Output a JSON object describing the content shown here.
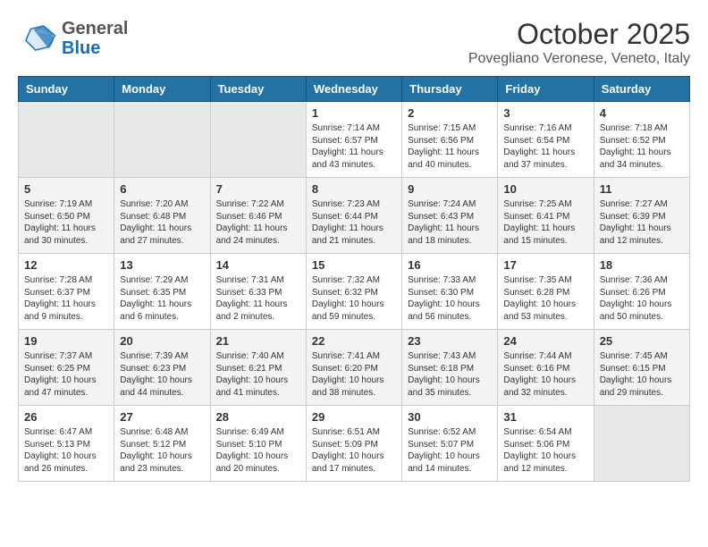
{
  "header": {
    "logo_general": "General",
    "logo_blue": "Blue",
    "month": "October 2025",
    "location": "Povegliano Veronese, Veneto, Italy"
  },
  "weekdays": [
    "Sunday",
    "Monday",
    "Tuesday",
    "Wednesday",
    "Thursday",
    "Friday",
    "Saturday"
  ],
  "weeks": [
    [
      {
        "day": "",
        "info": ""
      },
      {
        "day": "",
        "info": ""
      },
      {
        "day": "",
        "info": ""
      },
      {
        "day": "1",
        "info": "Sunrise: 7:14 AM\nSunset: 6:57 PM\nDaylight: 11 hours\nand 43 minutes."
      },
      {
        "day": "2",
        "info": "Sunrise: 7:15 AM\nSunset: 6:56 PM\nDaylight: 11 hours\nand 40 minutes."
      },
      {
        "day": "3",
        "info": "Sunrise: 7:16 AM\nSunset: 6:54 PM\nDaylight: 11 hours\nand 37 minutes."
      },
      {
        "day": "4",
        "info": "Sunrise: 7:18 AM\nSunset: 6:52 PM\nDaylight: 11 hours\nand 34 minutes."
      }
    ],
    [
      {
        "day": "5",
        "info": "Sunrise: 7:19 AM\nSunset: 6:50 PM\nDaylight: 11 hours\nand 30 minutes."
      },
      {
        "day": "6",
        "info": "Sunrise: 7:20 AM\nSunset: 6:48 PM\nDaylight: 11 hours\nand 27 minutes."
      },
      {
        "day": "7",
        "info": "Sunrise: 7:22 AM\nSunset: 6:46 PM\nDaylight: 11 hours\nand 24 minutes."
      },
      {
        "day": "8",
        "info": "Sunrise: 7:23 AM\nSunset: 6:44 PM\nDaylight: 11 hours\nand 21 minutes."
      },
      {
        "day": "9",
        "info": "Sunrise: 7:24 AM\nSunset: 6:43 PM\nDaylight: 11 hours\nand 18 minutes."
      },
      {
        "day": "10",
        "info": "Sunrise: 7:25 AM\nSunset: 6:41 PM\nDaylight: 11 hours\nand 15 minutes."
      },
      {
        "day": "11",
        "info": "Sunrise: 7:27 AM\nSunset: 6:39 PM\nDaylight: 11 hours\nand 12 minutes."
      }
    ],
    [
      {
        "day": "12",
        "info": "Sunrise: 7:28 AM\nSunset: 6:37 PM\nDaylight: 11 hours\nand 9 minutes."
      },
      {
        "day": "13",
        "info": "Sunrise: 7:29 AM\nSunset: 6:35 PM\nDaylight: 11 hours\nand 6 minutes."
      },
      {
        "day": "14",
        "info": "Sunrise: 7:31 AM\nSunset: 6:33 PM\nDaylight: 11 hours\nand 2 minutes."
      },
      {
        "day": "15",
        "info": "Sunrise: 7:32 AM\nSunset: 6:32 PM\nDaylight: 10 hours\nand 59 minutes."
      },
      {
        "day": "16",
        "info": "Sunrise: 7:33 AM\nSunset: 6:30 PM\nDaylight: 10 hours\nand 56 minutes."
      },
      {
        "day": "17",
        "info": "Sunrise: 7:35 AM\nSunset: 6:28 PM\nDaylight: 10 hours\nand 53 minutes."
      },
      {
        "day": "18",
        "info": "Sunrise: 7:36 AM\nSunset: 6:26 PM\nDaylight: 10 hours\nand 50 minutes."
      }
    ],
    [
      {
        "day": "19",
        "info": "Sunrise: 7:37 AM\nSunset: 6:25 PM\nDaylight: 10 hours\nand 47 minutes."
      },
      {
        "day": "20",
        "info": "Sunrise: 7:39 AM\nSunset: 6:23 PM\nDaylight: 10 hours\nand 44 minutes."
      },
      {
        "day": "21",
        "info": "Sunrise: 7:40 AM\nSunset: 6:21 PM\nDaylight: 10 hours\nand 41 minutes."
      },
      {
        "day": "22",
        "info": "Sunrise: 7:41 AM\nSunset: 6:20 PM\nDaylight: 10 hours\nand 38 minutes."
      },
      {
        "day": "23",
        "info": "Sunrise: 7:43 AM\nSunset: 6:18 PM\nDaylight: 10 hours\nand 35 minutes."
      },
      {
        "day": "24",
        "info": "Sunrise: 7:44 AM\nSunset: 6:16 PM\nDaylight: 10 hours\nand 32 minutes."
      },
      {
        "day": "25",
        "info": "Sunrise: 7:45 AM\nSunset: 6:15 PM\nDaylight: 10 hours\nand 29 minutes."
      }
    ],
    [
      {
        "day": "26",
        "info": "Sunrise: 6:47 AM\nSunset: 5:13 PM\nDaylight: 10 hours\nand 26 minutes."
      },
      {
        "day": "27",
        "info": "Sunrise: 6:48 AM\nSunset: 5:12 PM\nDaylight: 10 hours\nand 23 minutes."
      },
      {
        "day": "28",
        "info": "Sunrise: 6:49 AM\nSunset: 5:10 PM\nDaylight: 10 hours\nand 20 minutes."
      },
      {
        "day": "29",
        "info": "Sunrise: 6:51 AM\nSunset: 5:09 PM\nDaylight: 10 hours\nand 17 minutes."
      },
      {
        "day": "30",
        "info": "Sunrise: 6:52 AM\nSunset: 5:07 PM\nDaylight: 10 hours\nand 14 minutes."
      },
      {
        "day": "31",
        "info": "Sunrise: 6:54 AM\nSunset: 5:06 PM\nDaylight: 10 hours\nand 12 minutes."
      },
      {
        "day": "",
        "info": ""
      }
    ]
  ]
}
